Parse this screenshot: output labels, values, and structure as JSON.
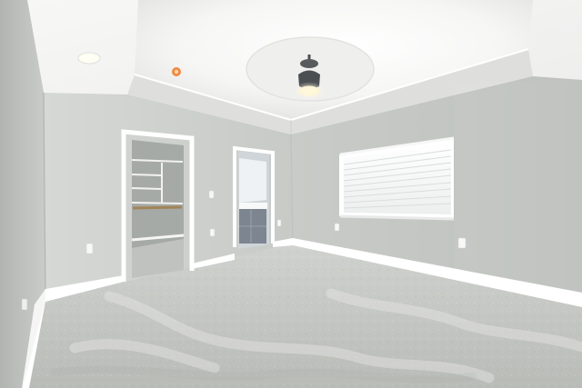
{
  "scene": {
    "kind": "empty-bedroom-photo"
  },
  "colors": {
    "wall_left": "#c7cac6",
    "wall_back": "#c9ccc8",
    "wall_right": "#c8cbc7",
    "ceiling": "#f4f4f2",
    "tray_recess": "#fbfbfa",
    "tray_soffit": "#dcdddb",
    "trim": "#ffffff",
    "carpet": "#c4c6c3",
    "carpet_shadow": "#b3b5b1",
    "closet_dark": "#8f938f",
    "bath_cabinet": "#7c8590",
    "window_blind": "#f7f7f6",
    "fan_motor": "#4c4f52",
    "light_glow": "#fff6d2",
    "smoke_detector": "#ef8a43"
  }
}
